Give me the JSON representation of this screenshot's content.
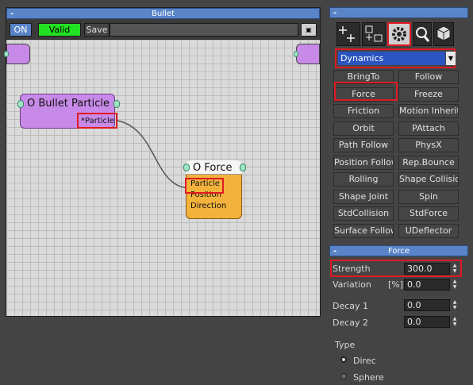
{
  "left_panel": {
    "title": "Bullet",
    "minus": "-",
    "toolbar": {
      "on_label": "ON",
      "valid_label": "Valid",
      "save_label": "Save",
      "field_value": ""
    },
    "nodes": {
      "bullet_particle": {
        "title": "O Bullet Particle",
        "output": "*Particle"
      },
      "force": {
        "title": "O Force",
        "inputs": [
          "Particle",
          "Position",
          "Direction"
        ]
      }
    }
  },
  "right_panel": {
    "top_minus": "-",
    "category_dropdown": {
      "selected": "Dynamics"
    },
    "operators": [
      "BringTo",
      "Follow",
      "Force",
      "Freeze",
      "Friction",
      "Motion Inherit.",
      "Orbit",
      "PAttach",
      "Path Follow",
      "PhysX",
      "Position Follow",
      "Rep.Bounce",
      "Rolling",
      "Shape Collision",
      "Shape Joint",
      "Spin",
      "StdCollision",
      "StdForce",
      "Surface Follow",
      "UDeflector"
    ],
    "force_section": {
      "title": "Force",
      "minus": "-",
      "strength": {
        "label": "Strength",
        "value": "300.0"
      },
      "variation": {
        "label": "Variation",
        "unit": "[%]",
        "value": "0.0"
      },
      "decay1": {
        "label": "Decay 1",
        "value": "0.0"
      },
      "decay2": {
        "label": "Decay 2",
        "value": "0.0"
      },
      "type": {
        "label": "Type",
        "options": [
          "Direc",
          "Sphere"
        ]
      }
    }
  },
  "colors": {
    "accent": "#5a84c8",
    "highlight": "#e01a22",
    "valid_green": "#22e022",
    "node_purple": "#c88ae8",
    "node_orange": "#f2b23c"
  }
}
